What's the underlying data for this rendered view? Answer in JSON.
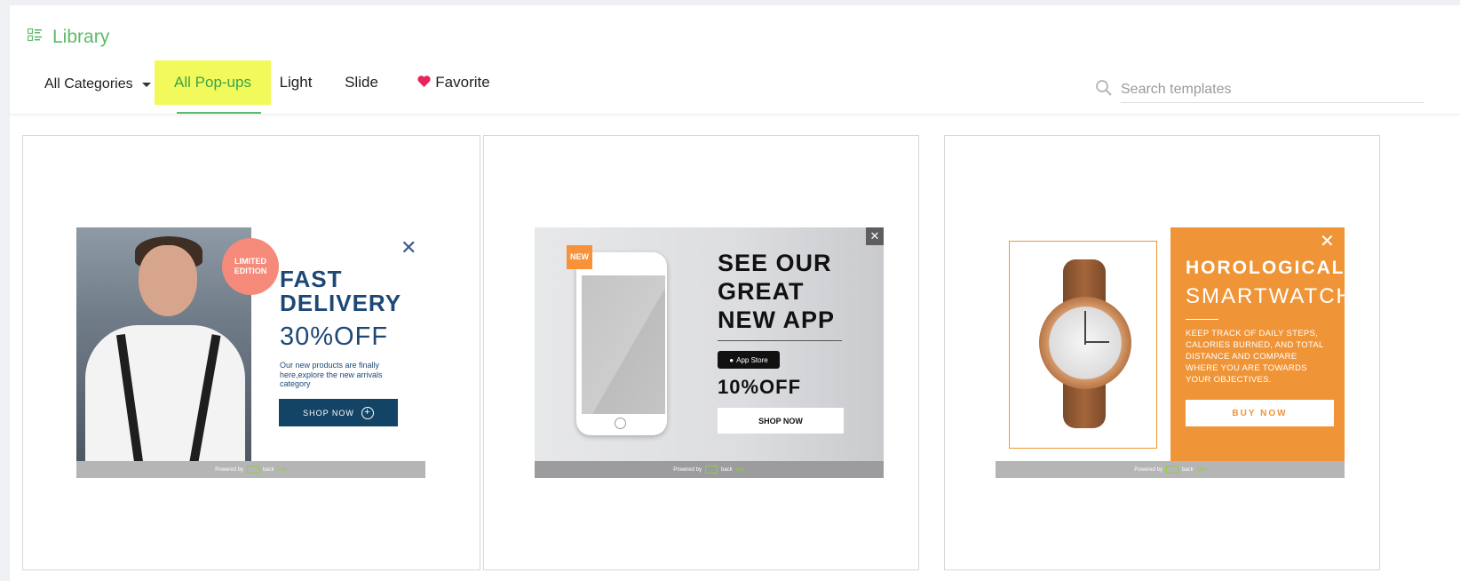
{
  "header": {
    "title": "Library",
    "categories_label": "All Categories",
    "tabs": [
      {
        "label": "All Pop-ups",
        "active": true
      },
      {
        "label": "Light",
        "active": false
      },
      {
        "label": "Slide",
        "active": false
      },
      {
        "label": "Favorite",
        "active": false
      }
    ],
    "search_placeholder": "Search templates",
    "search_value": ""
  },
  "colors": {
    "accent_green": "#5cbb68",
    "active_tab_highlight": "#f2fa5b",
    "favorite_heart": "#e8245a"
  },
  "templates": [
    {
      "badge": "LIMITED EDITION",
      "headline": "FAST DELIVERY",
      "offer": "30%OFF",
      "body": "Our new products are finally here,explore the new arrivals category",
      "button": "SHOP NOW",
      "footer_powered": "Powered by",
      "footer_brand_a": "back",
      "footer_brand_b": "cart"
    },
    {
      "badge": "NEW",
      "headline": "SEE OUR GREAT NEW APP",
      "store_badge": "App Store",
      "offer": "10%OFF",
      "button": "SHOP NOW",
      "footer_powered": "Powered by",
      "footer_brand_a": "back",
      "footer_brand_b": "cart"
    },
    {
      "headline": "HOROLOGICAL",
      "subheadline": "SMARTWATCH",
      "body": "KEEP TRACK OF DAILY STEPS, CALORIES BURNED, AND TOTAL DISTANCE AND COMPARE WHERE YOU ARE TOWARDS YOUR OBJECTIVES.",
      "button": "BUY NOW",
      "footer_powered": "Powered by",
      "footer_brand_a": "back",
      "footer_brand_b": "cart"
    }
  ]
}
